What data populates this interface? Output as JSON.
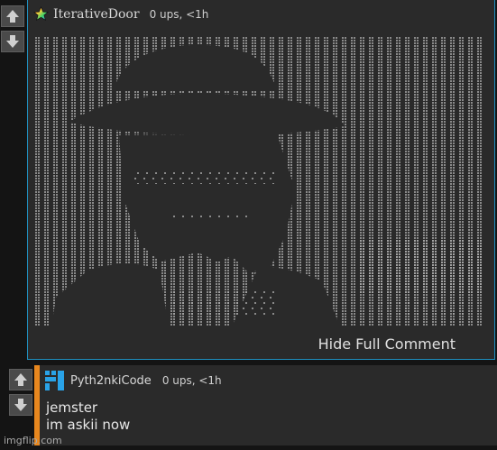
{
  "comment1": {
    "username": "IterativeDoor",
    "meta": "0 ups, <1h",
    "hide_label": "Hide Full Comment"
  },
  "comment2": {
    "username": "Pyth2nkiCode",
    "meta": "0 ups, <1h",
    "lines": [
      "jemster",
      "im askii now"
    ]
  },
  "watermark": "imgflip.com",
  "colors": {
    "selected_border": "#1f8fbf",
    "reply_accent": "#e8871e",
    "avatar_blue": "#29a3e8"
  }
}
